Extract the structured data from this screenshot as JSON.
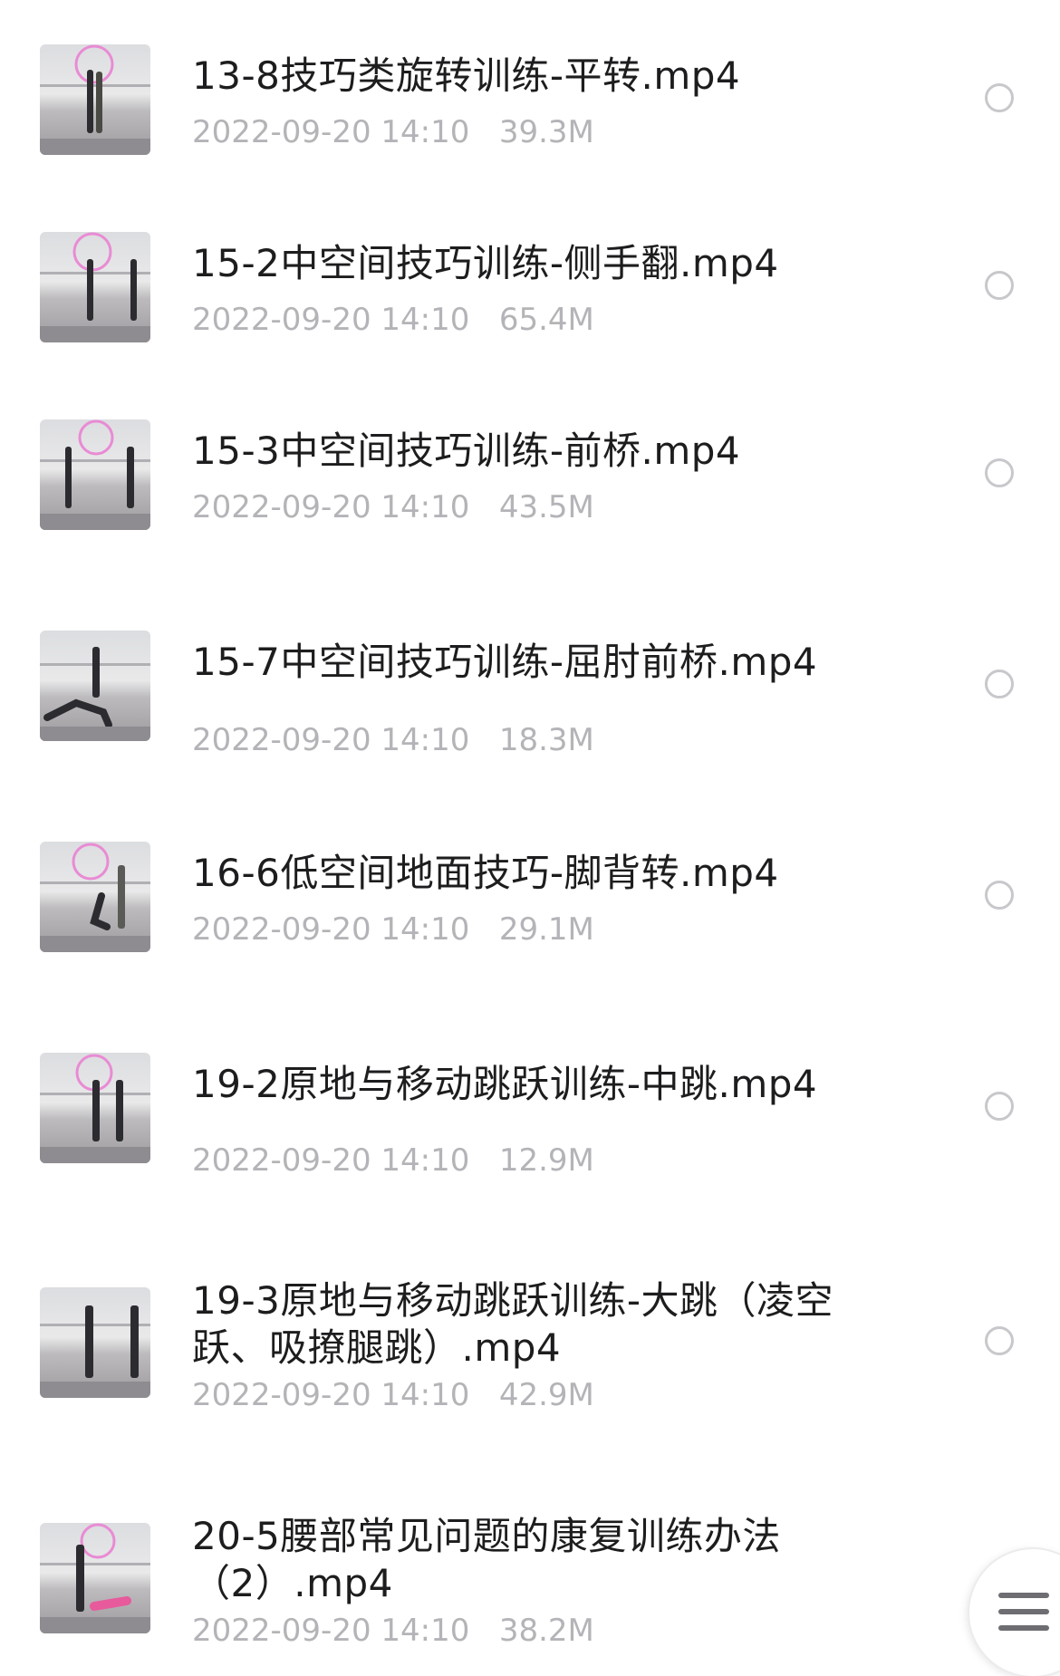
{
  "files": [
    {
      "name": "13-8技巧类旋转训练-平转.mp4",
      "date": "2022-09-20 14:10",
      "size": "39.3M"
    },
    {
      "name": "15-2中空间技巧训练-侧手翻.mp4",
      "date": "2022-09-20 14:10",
      "size": "65.4M"
    },
    {
      "name": "15-3中空间技巧训练-前桥.mp4",
      "date": "2022-09-20 14:10",
      "size": "43.5M"
    },
    {
      "name": "15-7中空间技巧训练-屈肘前桥.mp4",
      "date": "2022-09-20 14:10",
      "size": "18.3M"
    },
    {
      "name": "16-6低空间地面技巧-脚背转.mp4",
      "date": "2022-09-20 14:10",
      "size": "29.1M"
    },
    {
      "name": "19-2原地与移动跳跃训练-中跳.mp4",
      "date": "2022-09-20 14:10",
      "size": "12.9M"
    },
    {
      "name": "19-3原地与移动跳跃训练-大跳（凌空跃、吸撩腿跳）.mp4",
      "date": "2022-09-20 14:10",
      "size": "42.9M"
    },
    {
      "name": "20-5腰部常见问题的康复训练办法（2）.mp4",
      "date": "2022-09-20 14:10",
      "size": "38.2M"
    }
  ],
  "fab": {
    "icon": "menu-icon"
  }
}
